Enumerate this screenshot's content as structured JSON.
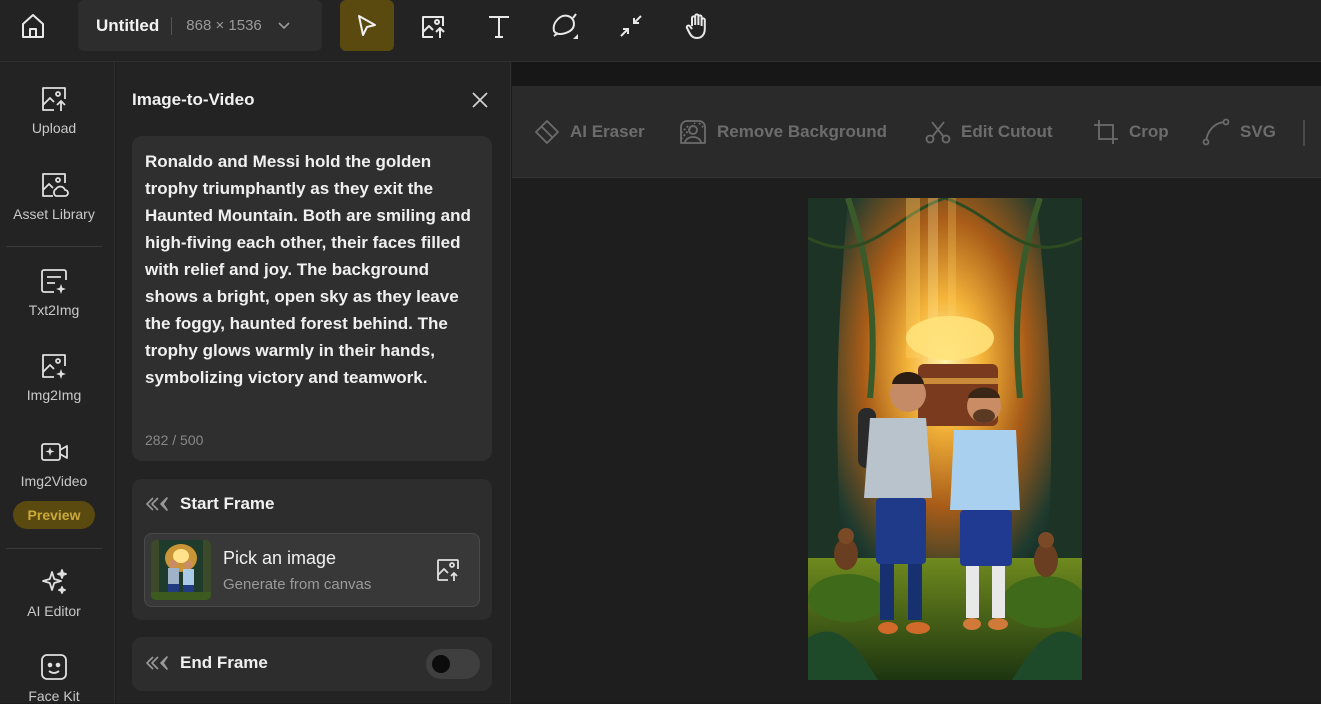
{
  "topbar": {
    "home_icon": "home-icon",
    "doc_title": "Untitled",
    "doc_size": "868 × 1536",
    "tools": [
      {
        "name": "select-tool",
        "icon": "cursor-arrow-icon",
        "active": true
      },
      {
        "name": "upload-image-tool",
        "icon": "image-upload-icon",
        "active": false
      },
      {
        "name": "text-tool",
        "icon": "text-T-icon",
        "active": false
      },
      {
        "name": "shape-tool",
        "icon": "shape-icon",
        "active": false
      },
      {
        "name": "fit-tool",
        "icon": "collapse-arrows-icon",
        "active": false
      },
      {
        "name": "hand-tool",
        "icon": "hand-icon",
        "active": false
      }
    ]
  },
  "sidebar": {
    "items": [
      {
        "label": "Upload",
        "icon": "upload-image-icon"
      },
      {
        "label": "Asset Library",
        "icon": "asset-library-icon"
      },
      {
        "label": "Txt2Img",
        "icon": "text-to-image-icon"
      },
      {
        "label": "Img2Img",
        "icon": "image-to-image-icon"
      },
      {
        "label": "Img2Video",
        "icon": "image-to-video-icon"
      },
      {
        "label": "AI Editor",
        "icon": "sparkle-icon"
      },
      {
        "label": "Face Kit",
        "icon": "face-icon"
      }
    ],
    "preview_badge": "Preview"
  },
  "panel": {
    "title": "Image-to-Video",
    "prompt": "Ronaldo and Messi hold the golden trophy triumphantly as they exit the Haunted Mountain. Both are smiling and high-fiving each other, their faces filled with relief and joy. The background shows a bright, open sky as they leave the foggy, haunted forest behind. The trophy glows warmly in their hands, symbolizing victory and teamwork.",
    "prompt_count": "282 / 500",
    "start_frame": {
      "title": "Start Frame",
      "pick_main": "Pick an image",
      "pick_sub": "Generate from canvas"
    },
    "end_frame": {
      "title": "End Frame",
      "enabled": false
    }
  },
  "context_toolbar": {
    "items": [
      {
        "label": "AI Eraser",
        "icon": "eraser-icon"
      },
      {
        "label": "Remove Background",
        "icon": "remove-background-icon"
      },
      {
        "label": "Edit Cutout",
        "icon": "scissors-icon"
      },
      {
        "label": "Crop",
        "icon": "crop-icon"
      },
      {
        "label": "SVG",
        "icon": "vector-pen-icon"
      }
    ]
  },
  "colors": {
    "accent": "#5a4a10",
    "accent_text": "#c9a93a",
    "background": "#1c1c1c",
    "panel": "#232323"
  }
}
